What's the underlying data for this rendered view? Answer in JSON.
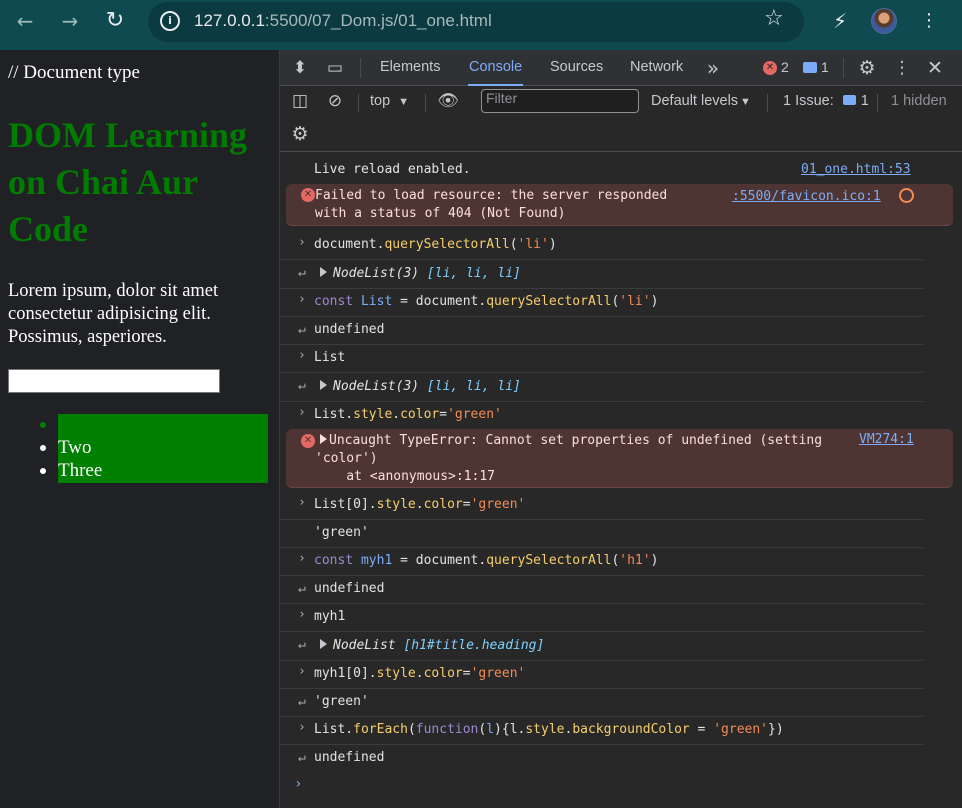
{
  "browser": {
    "url_host": "127.0.0.1",
    "url_rest": ":5500/07_Dom.js/01_one.html",
    "icons": [
      "back-arrow-icon",
      "forward-arrow-icon",
      "reload-icon",
      "site-info-icon",
      "bookmark-star-icon",
      "extension-icon",
      "kebab-menu-icon"
    ]
  },
  "page": {
    "doctype": "// Document type",
    "heading": "DOM Learning on Chai Aur Code",
    "paragraph": "Lorem ipsum, dolor sit amet consectetur adipisicing elit. Possimus, asperiores.",
    "list_items": [
      "",
      "Two",
      "Three"
    ],
    "heading_color": "#007d00",
    "list_bg_color": "#008000"
  },
  "devtools": {
    "tabs": [
      "Elements",
      "Console",
      "Sources",
      "Network"
    ],
    "active_tab": "Console",
    "error_count": "2",
    "message_count": "1",
    "context": "top",
    "filter_placeholder": "Filter",
    "levels": "Default levels",
    "issues_label": "1 Issue:",
    "issues_count": "1",
    "hidden": "1 hidden"
  },
  "console": {
    "live_reload": "Live reload enabled.",
    "live_reload_src": "01_one.html:53",
    "err1_line1": "Failed to load resource: the server responded",
    "err1_line2": "with a status of 404 (Not Found)",
    "err1_src": ":5500/favicon.ico:1",
    "err2_line1": "Uncaught TypeError: Cannot set properties of undefined (setting",
    "err2_line2": "'color')",
    "err2_line3": "    at <anonymous>:1:17",
    "err2_src": "VM274:1",
    "undefined": "undefined",
    "green_str": "'green'",
    "cmd_list": "List",
    "cmd_myh1": "myh1",
    "nodelist3": "NodeList(3)",
    "nodelist": "NodeList",
    "li_items": "[li, li, li]",
    "h1_item": "[h1#title.heading]"
  }
}
